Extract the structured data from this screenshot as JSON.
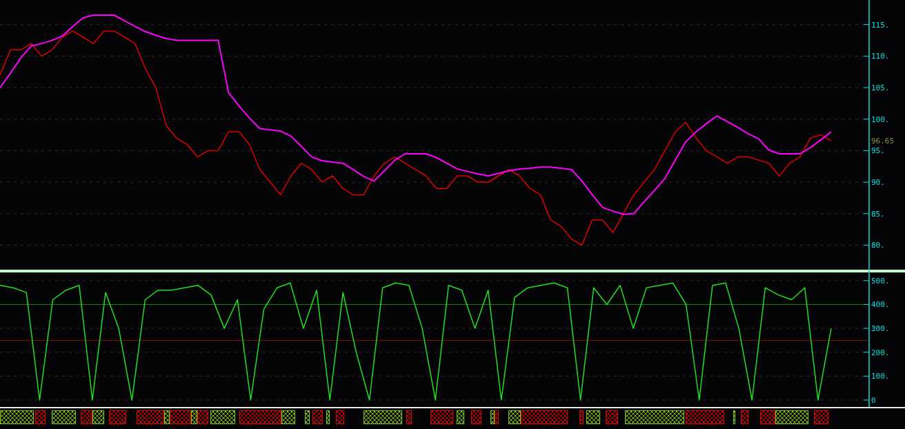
{
  "price_panel": {
    "chart_data": {
      "type": "line",
      "grid": true,
      "ylim": [
        76,
        118.8
      ],
      "yticks": [
        {
          "value": 80,
          "label": "80."
        },
        {
          "value": 85,
          "label": "85."
        },
        {
          "value": 90,
          "label": "90."
        },
        {
          "value": 95,
          "label": "95."
        },
        {
          "value": 100,
          "label": "100."
        },
        {
          "value": 105,
          "label": "105."
        },
        {
          "value": 110,
          "label": "110."
        },
        {
          "value": 115,
          "label": "115."
        }
      ],
      "annotations": [
        "96.65"
      ],
      "series": [
        {
          "color": "#e00000",
          "values": [
            107,
            111,
            111,
            112,
            110,
            111,
            113,
            114,
            113,
            112,
            114,
            114,
            113,
            112,
            108,
            105,
            99,
            97,
            96,
            94,
            95,
            95,
            98,
            98,
            96,
            92,
            90,
            88,
            91,
            93,
            92,
            90,
            91,
            89,
            88,
            88,
            91,
            93,
            94,
            93,
            92,
            91,
            89,
            89,
            91,
            91,
            90,
            90,
            91,
            92,
            91,
            89,
            88,
            84,
            83,
            81,
            80,
            84,
            84,
            82,
            85,
            88,
            90,
            92,
            95,
            98,
            99.5,
            97,
            95,
            94,
            93,
            94,
            94,
            93.5,
            93,
            91,
            93,
            94,
            97,
            97.5,
            96.6
          ]
        },
        {
          "color": "#ff00ff",
          "values": [
            105,
            107.3,
            109.7,
            111.6,
            112,
            112.5,
            113.2,
            114.7,
            116.1,
            116.5,
            116.5,
            116.5,
            115.6,
            114.7,
            113.9,
            113.3,
            112.8,
            112.5,
            112.5,
            112.5,
            112.5,
            112.5,
            104.2,
            102.1,
            100.2,
            98.5,
            98.3,
            98.1,
            97.3,
            95.7,
            94,
            93.4,
            93.2,
            93,
            92,
            90.9,
            90.2,
            91.8,
            93.5,
            94.5,
            94.5,
            94.5,
            93.9,
            93,
            92.1,
            91.7,
            91.3,
            91,
            91.4,
            91.8,
            92.1,
            92.2,
            92.4,
            92.4,
            92.2,
            92,
            90.2,
            88,
            86,
            85.4,
            84.9,
            85,
            86.9,
            88.7,
            90.6,
            93.5,
            96.4,
            98,
            99.3,
            100.5,
            99.6,
            98.7,
            97.7,
            96.9,
            95.1,
            94.5,
            94.5,
            94.5,
            95.5,
            96.7,
            98
          ]
        }
      ]
    }
  },
  "oscillator_panel": {
    "chart_data": {
      "type": "line",
      "grid": true,
      "ylim": [
        -26,
        537
      ],
      "yticks": [
        {
          "value": 0,
          "label": "0"
        },
        {
          "value": 100,
          "label": "100."
        },
        {
          "value": 200,
          "label": "200."
        },
        {
          "value": 300,
          "label": "300."
        },
        {
          "value": 400,
          "label": "400."
        },
        {
          "value": 500,
          "label": "500."
        }
      ],
      "ref_lines": [
        {
          "axis": "y",
          "value": 400,
          "color": "#0a8a0a"
        },
        {
          "axis": "y",
          "value": 250,
          "color": "#8a0a0a"
        }
      ],
      "series": [
        {
          "color": "#20e020",
          "values": [
            480,
            470,
            450,
            0,
            420,
            460,
            480,
            0,
            450,
            300,
            0,
            420,
            460,
            460,
            470,
            480,
            440,
            300,
            420,
            0,
            380,
            470,
            490,
            300,
            460,
            0,
            450,
            200,
            0,
            470,
            490,
            480,
            300,
            0,
            480,
            460,
            300,
            460,
            0,
            430,
            470,
            480,
            490,
            470,
            0,
            470,
            400,
            480,
            300,
            470,
            480,
            490,
            400,
            0,
            480,
            490,
            300,
            0,
            470,
            440,
            420,
            470,
            0,
            300
          ]
        }
      ]
    }
  }
}
